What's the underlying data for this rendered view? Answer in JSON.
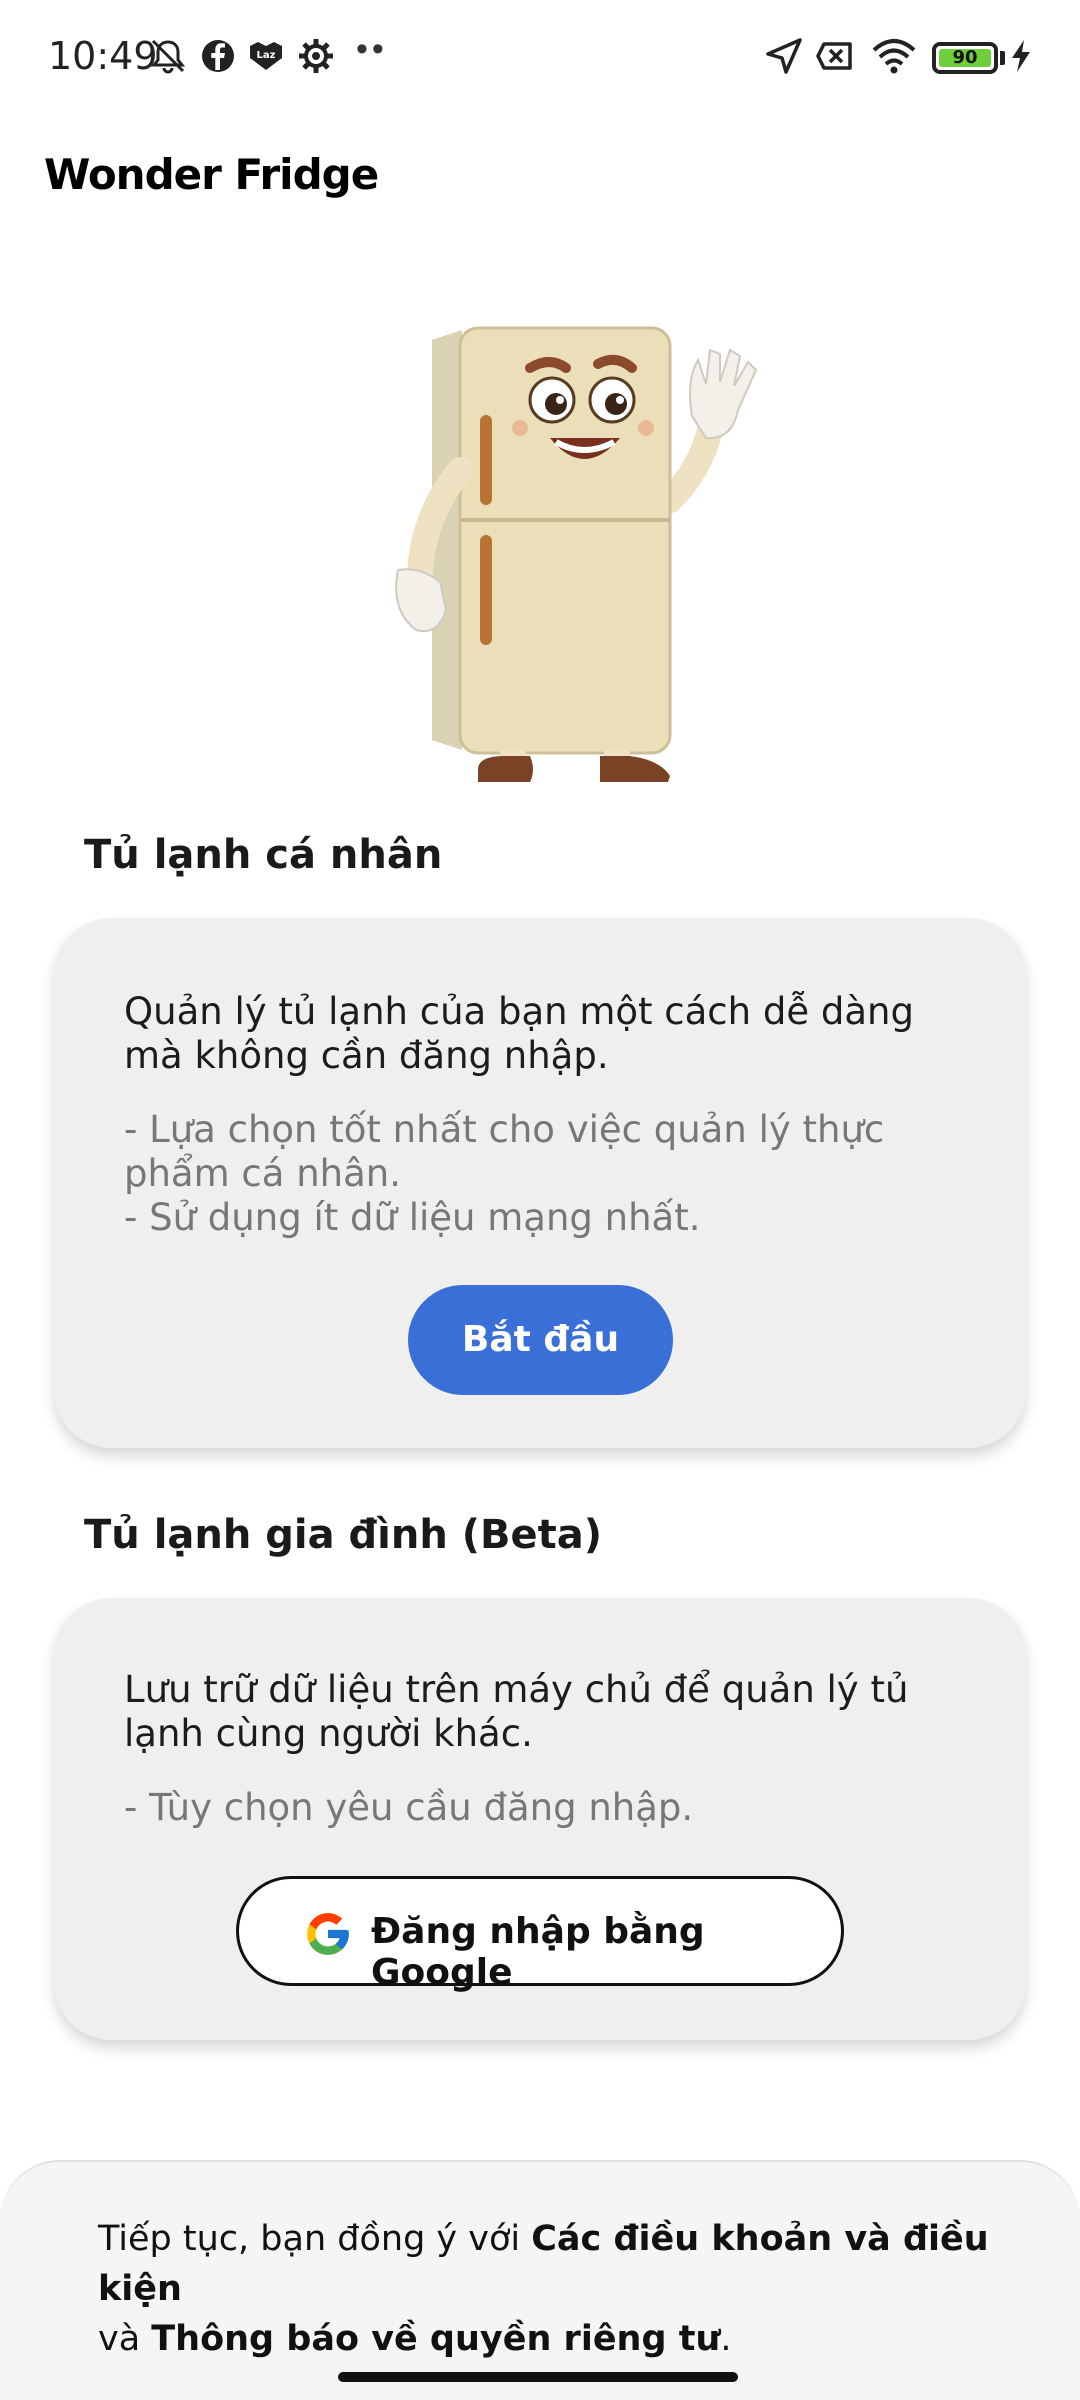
{
  "status_bar": {
    "time": "10:49",
    "left_icons": [
      "bell-off-icon",
      "facebook-icon",
      "lazada-icon",
      "settings-icon"
    ],
    "overflow": "••",
    "right_icons": [
      "location-arrow-icon",
      "sim-no-signal-icon",
      "wifi-icon"
    ],
    "battery_level": "90",
    "charging_icon": "bolt-icon"
  },
  "app": {
    "title": "Wonder Fridge"
  },
  "personal": {
    "title": "Tủ lạnh cá nhân",
    "description": "Quản lý tủ lạnh của bạn một cách dễ dàng mà không cần đăng nhập.",
    "bullet1": "- Lựa chọn tốt nhất cho việc quản lý thực phẩm cá nhân.",
    "bullet2": "- Sử dụng ít dữ liệu mạng nhất.",
    "button_label": "Bắt đầu"
  },
  "family": {
    "title": "Tủ lạnh gia đình (Beta)",
    "description": "Lưu trữ dữ liệu trên máy chủ để quản lý tủ lạnh cùng người khác.",
    "bullet1": "- Tùy chọn yêu cầu đăng nhập.",
    "button_label": "Đăng nhập bằng Google"
  },
  "footer": {
    "prefix": "Tiếp tục, bạn đồng ý với ",
    "terms_link": "Các điều khoản và điều kiện",
    "middle": "và ",
    "privacy_link": "Thông báo về quyền riêng tư",
    "suffix": "."
  },
  "colors": {
    "primary": "#3a6fd8",
    "card_bg": "#efefef",
    "muted_text": "#777777"
  }
}
